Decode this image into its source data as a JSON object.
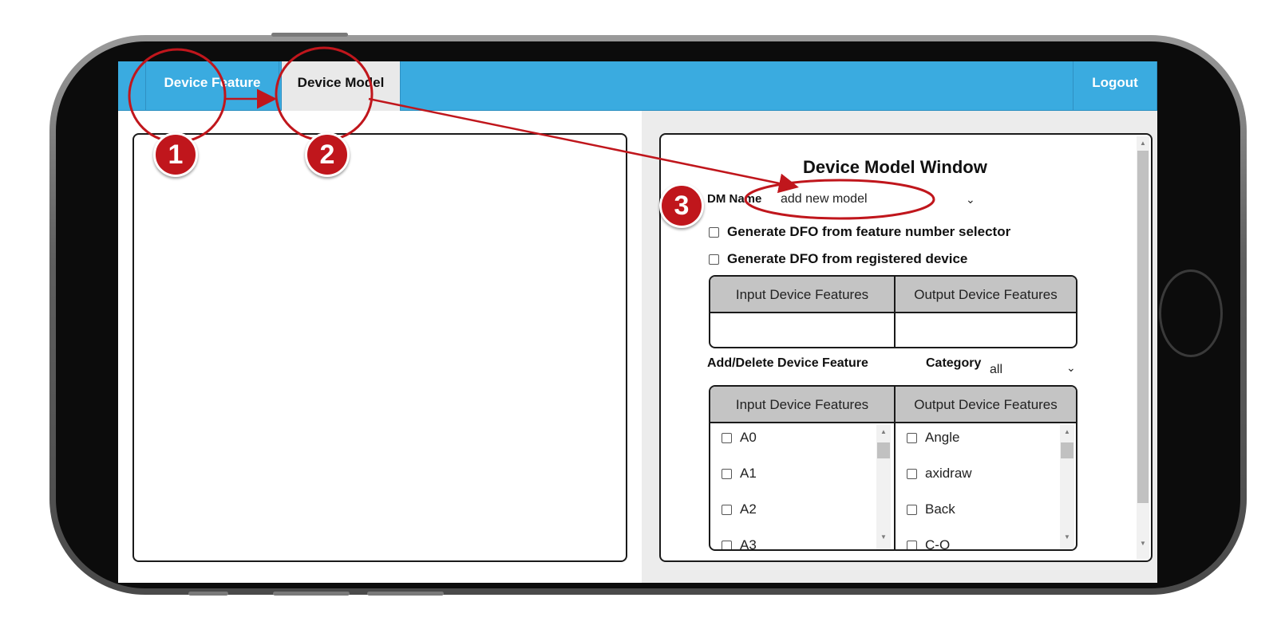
{
  "nav": {
    "tabs": [
      {
        "label": "Device Feature"
      },
      {
        "label": "Device Model"
      }
    ],
    "logout_label": "Logout"
  },
  "model_window": {
    "title": "Device Model Window",
    "dm_name_label": "DM Name",
    "dm_name_value": "add new model",
    "checkboxes": [
      {
        "label": "Generate DFO from feature number selector"
      },
      {
        "label": "Generate DFO from registered device"
      }
    ],
    "selected_table": {
      "input_header": "Input Device Features",
      "output_header": "Output Device Features"
    },
    "add_delete_label": "Add/Delete Device Feature",
    "category_label": "Category",
    "category_value": "all",
    "feature_table": {
      "input_header": "Input Device Features",
      "output_header": "Output Device Features",
      "input_items": [
        "A0",
        "A1",
        "A2",
        "A3"
      ],
      "output_items": [
        "Angle",
        "axidraw",
        "Back",
        "C-O"
      ]
    }
  },
  "annotations": {
    "markers": [
      "1",
      "2",
      "3"
    ],
    "color": "#c0161c"
  }
}
